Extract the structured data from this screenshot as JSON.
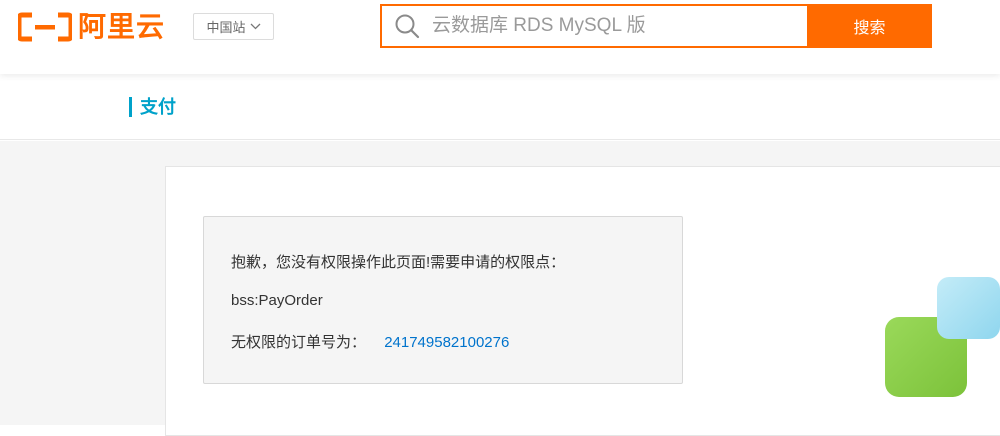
{
  "header": {
    "logo_text": "阿里云",
    "region_label": "中国站",
    "search": {
      "placeholder": "云数据库 RDS MySQL 版",
      "button_label": "搜索"
    }
  },
  "page": {
    "title": "支付"
  },
  "error": {
    "message": "抱歉，您没有权限操作此页面!需要申请的权限点：",
    "permission": "bss:PayOrder",
    "order_label": "无权限的订单号为：",
    "order_number": "241749582100276"
  },
  "colors": {
    "brand": "#ff6a00",
    "title_accent": "#00a2ca",
    "link": "#0073cc",
    "deco_green": "#8fd14f",
    "deco_blue": "#a6e0f2"
  },
  "icons": {
    "logo": "aliyun-logo-icon",
    "region_dropdown": "chevron-down-icon",
    "search": "search-icon"
  }
}
